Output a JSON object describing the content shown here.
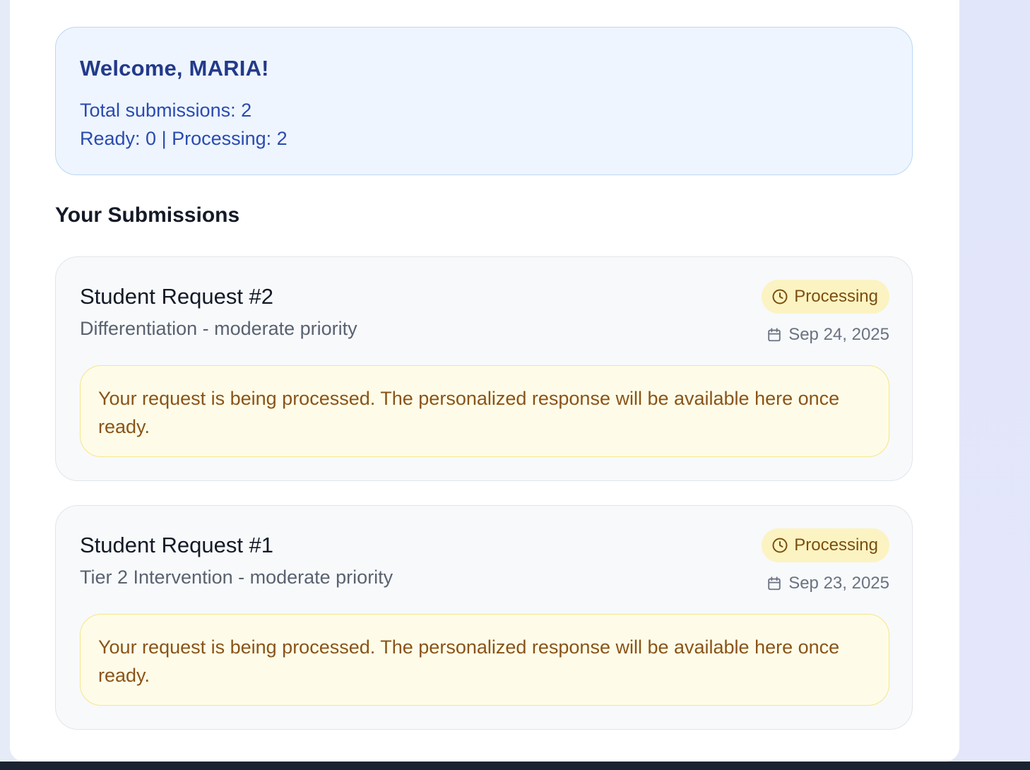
{
  "welcome": {
    "title": "Welcome, MARIA!",
    "total_line": "Total submissions: 2",
    "status_line": "Ready: 0 | Processing: 2"
  },
  "section_title": "Your Submissions",
  "submissions": [
    {
      "title": "Student Request #2",
      "subtitle": "Differentiation - moderate priority",
      "status": "Processing",
      "status_icon": "clock-icon",
      "date_icon": "calendar-icon",
      "date": "Sep 24, 2025",
      "message": "Your request is being processed. The personalized response will be available here once ready."
    },
    {
      "title": "Student Request #1",
      "subtitle": "Tier 2 Intervention - moderate priority",
      "status": "Processing",
      "status_icon": "clock-icon",
      "date_icon": "calendar-icon",
      "date": "Sep 23, 2025",
      "message": "Your request is being processed. The personalized response will be available here once ready."
    }
  ],
  "colors": {
    "welcome_bg": "#eef5fe",
    "welcome_text": "#233a8a",
    "badge_bg": "#fcf3c2",
    "badge_text": "#7a4f10",
    "notice_bg": "#fefce8",
    "notice_border": "#f6e68a",
    "notice_text": "#8a5418"
  }
}
